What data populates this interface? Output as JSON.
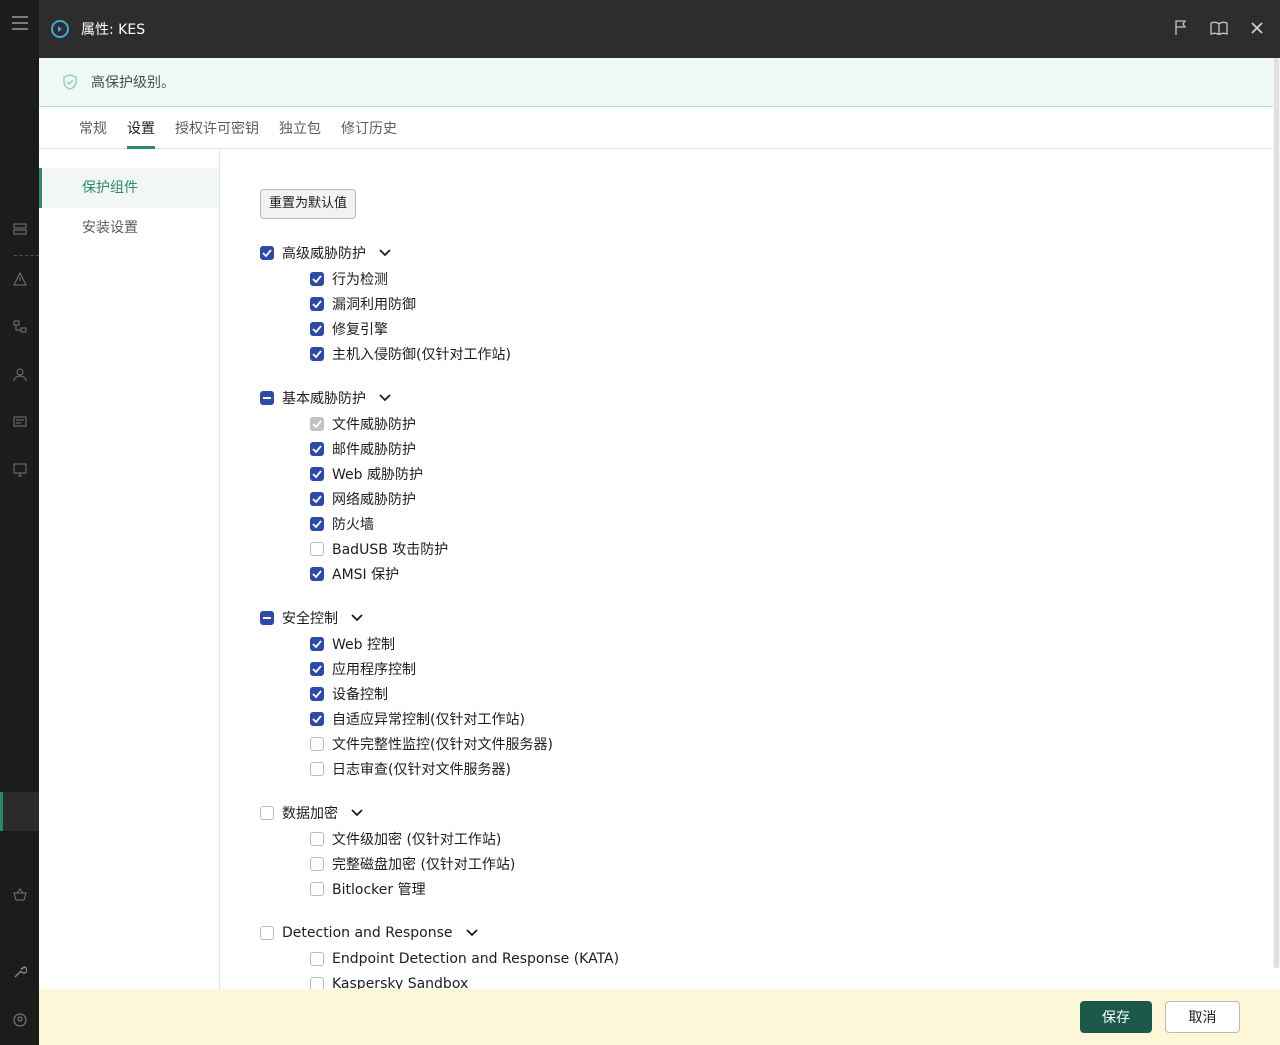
{
  "window": {
    "title": "属性: KES"
  },
  "banner": {
    "message": "高保护级别。"
  },
  "tabs": [
    {
      "label": "常规",
      "active": false
    },
    {
      "label": "设置",
      "active": true
    },
    {
      "label": "授权许可密钥",
      "active": false
    },
    {
      "label": "独立包",
      "active": false
    },
    {
      "label": "修订历史",
      "active": false
    }
  ],
  "sidebar": {
    "items": [
      {
        "label": "保护组件",
        "active": true
      },
      {
        "label": "安装设置",
        "active": false
      }
    ]
  },
  "content": {
    "reset_label": "重置为默认值",
    "groups": [
      {
        "label": "高级威胁防护",
        "state": "checked",
        "items": [
          {
            "label": "行为检测",
            "state": "checked"
          },
          {
            "label": "漏洞利用防御",
            "state": "checked"
          },
          {
            "label": "修复引擎",
            "state": "checked"
          },
          {
            "label": "主机入侵防御(仅针对工作站)",
            "state": "checked"
          }
        ]
      },
      {
        "label": "基本威胁防护",
        "state": "indeterminate",
        "items": [
          {
            "label": "文件威胁防护",
            "state": "disabled-checked"
          },
          {
            "label": "邮件威胁防护",
            "state": "checked"
          },
          {
            "label": "Web 威胁防护",
            "state": "checked"
          },
          {
            "label": "网络威胁防护",
            "state": "checked"
          },
          {
            "label": "防火墙",
            "state": "checked"
          },
          {
            "label": "BadUSB 攻击防护",
            "state": "unchecked"
          },
          {
            "label": "AMSI 保护",
            "state": "checked"
          }
        ]
      },
      {
        "label": "安全控制",
        "state": "indeterminate",
        "items": [
          {
            "label": "Web 控制",
            "state": "checked"
          },
          {
            "label": "应用程序控制",
            "state": "checked"
          },
          {
            "label": "设备控制",
            "state": "checked"
          },
          {
            "label": "自适应异常控制(仅针对工作站)",
            "state": "checked"
          },
          {
            "label": "文件完整性监控(仅针对文件服务器)",
            "state": "unchecked"
          },
          {
            "label": "日志审查(仅针对文件服务器)",
            "state": "unchecked"
          }
        ]
      },
      {
        "label": "数据加密",
        "state": "unchecked",
        "items": [
          {
            "label": "文件级加密 (仅针对工作站)",
            "state": "unchecked"
          },
          {
            "label": "完整磁盘加密 (仅针对工作站)",
            "state": "unchecked"
          },
          {
            "label": "Bitlocker 管理",
            "state": "unchecked"
          }
        ]
      },
      {
        "label": "Detection and Response",
        "state": "unchecked",
        "items": [
          {
            "label": "Endpoint Detection and Response (KATA)",
            "state": "unchecked"
          },
          {
            "label": "Kaspersky Sandbox",
            "state": "unchecked"
          }
        ]
      }
    ]
  },
  "footer": {
    "save_label": "保存",
    "cancel_label": "取消"
  },
  "colors": {
    "accent": "#2c8a6b",
    "checkbox": "#2e4aa8",
    "save_button": "#1b5a49",
    "footer_bg": "#fdf7d8",
    "banner_bg": "#eef8f5"
  },
  "icons": [
    "menu-icon",
    "app-icon",
    "flag-icon",
    "book-icon",
    "close-icon",
    "shield-check-icon",
    "chevron-down-icon"
  ]
}
